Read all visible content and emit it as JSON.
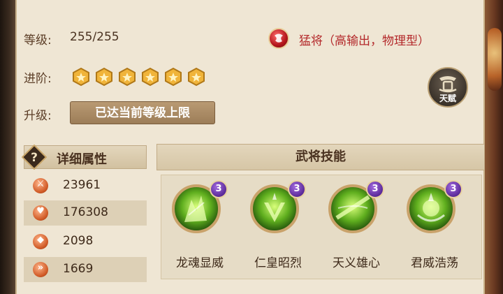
{
  "stats": {
    "level_label": "等级:",
    "level_value": "255/255",
    "advance_label": "进阶:",
    "advance_stars": 6,
    "upgrade_label": "升级:",
    "upgrade_button": "已达当前等级上限"
  },
  "hero_type": {
    "text": "猛将（高输出，物理型）",
    "icon": "red-orb-icon",
    "color": "#b3282a"
  },
  "talent": {
    "label": "天赋",
    "icon": "talent-emblem-icon"
  },
  "attributes": {
    "header": "详细属性",
    "help_icon": "question-mark-icon",
    "items": [
      {
        "icon": "attack-icon",
        "value": "23961"
      },
      {
        "icon": "heart-icon",
        "value": "176308"
      },
      {
        "icon": "defense-icon",
        "value": "2098"
      },
      {
        "icon": "speed-icon",
        "value": "1669"
      }
    ]
  },
  "skills": {
    "header": "武将技能",
    "items": [
      {
        "name": "龙魂显威",
        "level": "3"
      },
      {
        "name": "仁皇昭烈",
        "level": "3"
      },
      {
        "name": "天义雄心",
        "level": "3"
      },
      {
        "name": "君威浩荡",
        "level": "3"
      }
    ]
  }
}
